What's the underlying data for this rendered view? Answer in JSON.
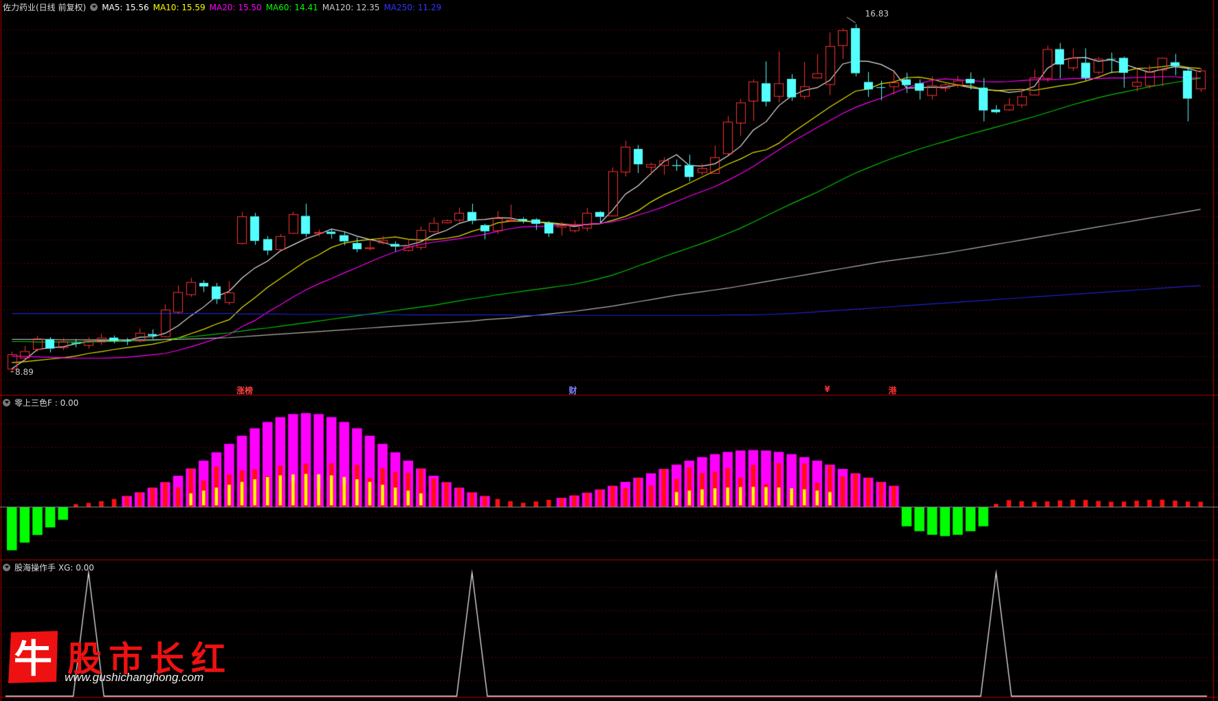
{
  "header": {
    "stock_title": "佐力药业(日线 前复权)",
    "ma_items": [
      {
        "label": "MA5: 15.56",
        "color": "#ffffff"
      },
      {
        "label": "MA10: 15.59",
        "color": "#ffff00"
      },
      {
        "label": "MA20: 15.50",
        "color": "#ff00ff"
      },
      {
        "label": "MA60: 14.41",
        "color": "#00ff00"
      },
      {
        "label": "MA120: 12.35",
        "color": "#cccccc"
      },
      {
        "label": "MA250: 11.29",
        "color": "#3030ff"
      }
    ]
  },
  "indicator1": {
    "title": "零上三色F : 0.00"
  },
  "indicator2": {
    "title": "股海操作手 XG: 0.00"
  },
  "annotations": {
    "high_label": "16.83",
    "low_label": "8.89",
    "event_markers": [
      {
        "text": "涨榜",
        "index": 18,
        "color": "#ff4040"
      },
      {
        "text": "财",
        "index": 44,
        "color": "#8080ff"
      },
      {
        "text": "¥",
        "index": 64,
        "color": "#ff3030"
      },
      {
        "text": "港",
        "index": 69,
        "color": "#ff3030"
      }
    ]
  },
  "watermark": {
    "brand_char": "牛",
    "text": "股市长红",
    "url": "www.gushichanghong.com"
  },
  "chart_data": {
    "type": "candlestick",
    "price_range": [
      8.6,
      17.1
    ],
    "candles": [
      [
        8.96,
        9.29,
        9.35,
        8.89
      ],
      [
        9.21,
        9.36,
        9.48,
        9.14
      ],
      [
        9.41,
        9.65,
        9.71,
        9.35
      ],
      [
        9.63,
        9.42,
        9.68,
        9.33
      ],
      [
        9.45,
        9.58,
        9.66,
        9.38
      ],
      [
        9.55,
        9.53,
        9.64,
        9.45
      ],
      [
        9.5,
        9.61,
        9.68,
        9.42
      ],
      [
        9.58,
        9.67,
        9.76,
        9.5
      ],
      [
        9.67,
        9.6,
        9.72,
        9.54
      ],
      [
        9.6,
        9.59,
        9.66,
        9.5
      ],
      [
        9.6,
        9.78,
        9.88,
        9.56
      ],
      [
        9.75,
        9.71,
        9.86,
        9.64
      ],
      [
        9.7,
        10.31,
        10.43,
        9.68
      ],
      [
        10.26,
        10.71,
        10.86,
        10.21
      ],
      [
        10.66,
        10.94,
        11.04,
        10.6
      ],
      [
        10.92,
        10.84,
        10.98,
        10.71
      ],
      [
        10.84,
        10.55,
        10.92,
        10.44
      ],
      [
        10.48,
        10.7,
        10.96,
        10.42
      ],
      [
        11.83,
        12.44,
        12.54,
        11.8
      ],
      [
        12.44,
        11.88,
        12.52,
        11.79
      ],
      [
        11.92,
        11.66,
        11.99,
        11.56
      ],
      [
        11.69,
        11.99,
        12.04,
        11.66
      ],
      [
        12.06,
        12.49,
        12.55,
        12.04
      ],
      [
        12.45,
        12.04,
        12.73,
        11.97
      ],
      [
        12.06,
        12.08,
        12.14,
        11.98
      ],
      [
        12.09,
        12.04,
        12.16,
        11.93
      ],
      [
        12.01,
        11.87,
        12.1,
        11.78
      ],
      [
        11.83,
        11.69,
        11.96,
        11.62
      ],
      [
        11.71,
        11.73,
        11.91,
        11.66
      ],
      [
        11.84,
        11.9,
        11.99,
        11.8
      ],
      [
        11.81,
        11.75,
        11.87,
        11.64
      ],
      [
        11.67,
        11.75,
        11.92,
        11.64
      ],
      [
        11.74,
        12.13,
        12.21,
        11.67
      ],
      [
        12.1,
        12.29,
        12.41,
        12.07
      ],
      [
        12.3,
        12.35,
        12.37,
        12.28
      ],
      [
        12.36,
        12.52,
        12.64,
        12.31
      ],
      [
        12.54,
        12.34,
        12.73,
        12.26
      ],
      [
        12.24,
        12.1,
        12.27,
        11.92
      ],
      [
        12.12,
        12.4,
        12.56,
        12.04
      ],
      [
        12.35,
        12.36,
        12.71,
        12.33
      ],
      [
        12.38,
        12.34,
        12.42,
        12.28
      ],
      [
        12.37,
        12.27,
        12.4,
        12.13
      ],
      [
        12.29,
        12.05,
        12.33,
        11.97
      ],
      [
        12.2,
        12.24,
        12.31,
        12.0
      ],
      [
        12.12,
        12.26,
        12.34,
        12.07
      ],
      [
        12.18,
        12.52,
        12.63,
        12.1
      ],
      [
        12.54,
        12.43,
        12.56,
        12.3
      ],
      [
        12.46,
        13.47,
        13.56,
        12.44
      ],
      [
        13.46,
        14.03,
        14.17,
        13.35
      ],
      [
        13.98,
        13.63,
        14.07,
        13.43
      ],
      [
        13.57,
        13.63,
        13.67,
        13.39
      ],
      [
        13.61,
        13.72,
        13.79,
        13.39
      ],
      [
        13.61,
        13.59,
        13.74,
        13.48
      ],
      [
        13.61,
        13.34,
        13.85,
        13.24
      ],
      [
        13.45,
        13.54,
        13.64,
        13.38
      ],
      [
        13.43,
        13.79,
        14.06,
        13.41
      ],
      [
        13.88,
        14.6,
        14.73,
        13.84
      ],
      [
        14.58,
        15.04,
        15.12,
        14.28
      ],
      [
        15.08,
        15.52,
        15.57,
        14.62
      ],
      [
        15.48,
        15.06,
        15.98,
        14.95
      ],
      [
        15.19,
        15.48,
        16.21,
        15.04
      ],
      [
        15.58,
        15.16,
        15.69,
        15.08
      ],
      [
        15.19,
        15.41,
        15.97,
        15.12
      ],
      [
        15.61,
        15.71,
        16.14,
        15.59
      ],
      [
        15.46,
        16.33,
        16.64,
        15.21
      ],
      [
        16.35,
        16.69,
        16.74,
        16.03
      ],
      [
        16.74,
        15.71,
        16.83,
        15.64
      ],
      [
        15.51,
        15.34,
        15.74,
        15.17
      ],
      [
        15.39,
        15.38,
        15.54,
        15.09
      ],
      [
        15.41,
        15.5,
        15.75,
        15.22
      ],
      [
        15.57,
        15.44,
        15.72,
        15.26
      ],
      [
        15.48,
        15.31,
        15.57,
        15.11
      ],
      [
        15.21,
        15.43,
        15.64,
        15.11
      ],
      [
        15.37,
        15.45,
        15.49,
        15.28
      ],
      [
        15.44,
        15.54,
        15.65,
        15.38
      ],
      [
        15.58,
        15.48,
        15.73,
        15.34
      ],
      [
        15.38,
        14.86,
        15.6,
        14.61
      ],
      [
        14.88,
        14.82,
        14.98,
        14.79
      ],
      [
        14.88,
        14.99,
        15.14,
        14.85
      ],
      [
        14.99,
        15.18,
        15.35,
        14.92
      ],
      [
        15.22,
        15.61,
        15.79,
        15.2
      ],
      [
        15.6,
        16.26,
        16.34,
        15.51
      ],
      [
        16.26,
        15.91,
        16.4,
        15.59
      ],
      [
        15.84,
        16.06,
        16.28,
        15.76
      ],
      [
        15.95,
        15.6,
        16.28,
        15.54
      ],
      [
        15.74,
        16.04,
        16.08,
        15.68
      ],
      [
        16.04,
        16.03,
        16.18,
        15.71
      ],
      [
        16.06,
        15.72,
        16.09,
        15.38
      ],
      [
        15.42,
        15.51,
        15.8,
        15.29
      ],
      [
        15.43,
        15.74,
        15.89,
        15.36
      ],
      [
        15.79,
        16.06,
        16.07,
        15.41
      ],
      [
        15.96,
        15.87,
        16.15,
        15.66
      ],
      [
        15.77,
        15.13,
        15.86,
        14.61
      ],
      [
        15.36,
        15.77,
        15.82,
        15.28
      ]
    ],
    "ma_lines": [
      {
        "name": "MA5",
        "color": "#e8e8e8",
        "values": [
          8.96,
          9.16,
          9.4,
          9.44,
          9.46,
          9.53,
          9.58,
          9.6,
          9.6,
          9.6,
          9.68,
          9.69,
          9.77,
          9.94,
          10.17,
          10.37,
          10.61,
          10.73,
          11.03,
          11.26,
          11.42,
          11.65,
          11.79,
          11.93,
          12.03,
          12.15,
          12.09,
          11.99,
          11.91,
          11.85,
          11.76,
          11.78,
          11.86,
          12.02,
          12.12,
          12.28,
          12.36,
          12.37,
          12.41,
          12.4,
          12.34,
          12.32,
          12.28,
          12.25,
          12.21,
          12.26,
          12.28,
          12.58,
          12.95,
          13.14,
          13.42,
          13.69,
          13.85,
          13.6,
          13.59,
          13.64,
          13.82,
          14.04,
          14.41,
          14.6,
          14.97,
          15.19,
          15.32,
          15.38,
          15.55,
          15.92,
          15.99,
          15.98,
          15.91,
          15.76,
          15.37,
          15.38,
          15.39,
          15.39,
          15.44,
          15.38,
          15.34,
          15.32,
          15.27,
          15.3,
          15.41,
          15.82,
          16.0,
          16.06,
          16.07,
          15.98,
          16.02,
          15.92,
          15.82,
          15.73,
          15.8,
          15.86,
          15.82,
          15.74
        ]
      },
      {
        "name": "MA10",
        "color": "#e8e800",
        "values": [
          9.1,
          9.12,
          9.15,
          9.18,
          9.21,
          9.25,
          9.31,
          9.35,
          9.4,
          9.44,
          9.48,
          9.52,
          9.58,
          9.66,
          9.76,
          9.86,
          9.98,
          10.08,
          10.36,
          10.58,
          10.82,
          11.02,
          11.22,
          11.42,
          11.56,
          11.73,
          11.83,
          11.88,
          11.91,
          11.94,
          11.97,
          11.92,
          11.9,
          11.91,
          11.94,
          11.99,
          12.1,
          12.18,
          12.29,
          12.33,
          12.33,
          12.31,
          12.3,
          12.27,
          12.24,
          12.25,
          12.27,
          12.35,
          12.44,
          12.57,
          12.77,
          12.93,
          13.06,
          13.2,
          13.34,
          13.48,
          13.63,
          13.75,
          13.9,
          13.96,
          14.11,
          14.34,
          14.54,
          14.74,
          14.94,
          15.12,
          15.3,
          15.35,
          15.47,
          15.51,
          15.61,
          15.62,
          15.57,
          15.5,
          15.44,
          15.42,
          15.34,
          15.31,
          15.33,
          15.34,
          15.32,
          15.37,
          15.42,
          15.46,
          15.53,
          15.62,
          15.73,
          15.75,
          15.82,
          15.83,
          15.86,
          15.9,
          15.84,
          15.82
        ]
      },
      {
        "name": "MA20",
        "color": "#ff00ff",
        "values": [
          9.25,
          9.24,
          9.23,
          9.22,
          9.21,
          9.2,
          9.2,
          9.2,
          9.21,
          9.22,
          9.25,
          9.28,
          9.31,
          9.38,
          9.46,
          9.55,
          9.65,
          9.74,
          9.92,
          10.06,
          10.25,
          10.42,
          10.6,
          10.76,
          10.9,
          11.02,
          11.15,
          11.27,
          11.4,
          11.52,
          11.63,
          11.73,
          11.8,
          11.85,
          11.89,
          11.93,
          11.98,
          12.03,
          12.1,
          12.16,
          12.2,
          12.21,
          12.22,
          12.23,
          12.24,
          12.26,
          12.28,
          12.32,
          12.38,
          12.47,
          12.56,
          12.66,
          12.78,
          12.9,
          13.01,
          13.12,
          13.26,
          13.41,
          13.58,
          13.77,
          13.96,
          14.14,
          14.3,
          14.47,
          14.63,
          14.79,
          14.93,
          15.04,
          15.14,
          15.26,
          15.37,
          15.47,
          15.55,
          15.58,
          15.56,
          15.54,
          15.52,
          15.51,
          15.52,
          15.54,
          15.56,
          15.56,
          15.57,
          15.59,
          15.59,
          15.59,
          15.6,
          15.6,
          15.61,
          15.62,
          15.63,
          15.63,
          15.6,
          15.6
        ]
      },
      {
        "name": "MA60",
        "color": "#00c800",
        "values": [
          9.58,
          9.58,
          9.57,
          9.57,
          9.57,
          9.57,
          9.57,
          9.58,
          9.58,
          9.59,
          9.6,
          9.61,
          9.63,
          9.66,
          9.69,
          9.72,
          9.75,
          9.78,
          9.82,
          9.86,
          9.89,
          9.93,
          9.97,
          10.01,
          10.05,
          10.09,
          10.13,
          10.17,
          10.21,
          10.25,
          10.29,
          10.33,
          10.37,
          10.41,
          10.46,
          10.51,
          10.56,
          10.6,
          10.65,
          10.69,
          10.73,
          10.77,
          10.81,
          10.85,
          10.89,
          10.95,
          11.02,
          11.1,
          11.2,
          11.31,
          11.41,
          11.52,
          11.62,
          11.72,
          11.82,
          11.93,
          12.05,
          12.17,
          12.31,
          12.45,
          12.59,
          12.73,
          12.86,
          12.99,
          13.14,
          13.29,
          13.43,
          13.55,
          13.67,
          13.78,
          13.88,
          13.98,
          14.07,
          14.15,
          14.24,
          14.32,
          14.4,
          14.48,
          14.56,
          14.64,
          14.72,
          14.81,
          14.9,
          14.99,
          15.07,
          15.15,
          15.22,
          15.28,
          15.34,
          15.4,
          15.45,
          15.5,
          15.55,
          15.6
        ]
      },
      {
        "name": "MA120",
        "color": "#b4b4b4",
        "values": [
          9.63,
          9.63,
          9.63,
          9.63,
          9.62,
          9.62,
          9.62,
          9.62,
          9.62,
          9.62,
          9.62,
          9.62,
          9.63,
          9.63,
          9.64,
          9.65,
          9.66,
          9.67,
          9.69,
          9.71,
          9.73,
          9.75,
          9.77,
          9.79,
          9.81,
          9.83,
          9.85,
          9.87,
          9.89,
          9.91,
          9.93,
          9.95,
          9.97,
          9.99,
          10.01,
          10.03,
          10.05,
          10.08,
          10.1,
          10.12,
          10.15,
          10.18,
          10.21,
          10.24,
          10.27,
          10.31,
          10.35,
          10.39,
          10.44,
          10.49,
          10.54,
          10.59,
          10.64,
          10.68,
          10.72,
          10.76,
          10.8,
          10.85,
          10.9,
          10.95,
          11.0,
          11.05,
          11.1,
          11.15,
          11.2,
          11.25,
          11.3,
          11.35,
          11.4,
          11.44,
          11.48,
          11.52,
          11.56,
          11.6,
          11.65,
          11.7,
          11.75,
          11.8,
          11.85,
          11.9,
          11.95,
          12.0,
          12.05,
          12.1,
          12.15,
          12.2,
          12.25,
          12.3,
          12.35,
          12.4,
          12.45,
          12.5,
          12.55,
          12.6
        ]
      },
      {
        "name": "MA250",
        "color": "#2020d0",
        "values": [
          10.22,
          10.22,
          10.22,
          10.22,
          10.22,
          10.22,
          10.22,
          10.22,
          10.22,
          10.22,
          10.22,
          10.22,
          10.22,
          10.22,
          10.22,
          10.22,
          10.22,
          10.22,
          10.21,
          10.21,
          10.21,
          10.21,
          10.2,
          10.2,
          10.2,
          10.2,
          10.2,
          10.2,
          10.2,
          10.2,
          10.2,
          10.19,
          10.19,
          10.19,
          10.19,
          10.19,
          10.19,
          10.19,
          10.19,
          10.19,
          10.18,
          10.18,
          10.18,
          10.18,
          10.18,
          10.18,
          10.18,
          10.18,
          10.18,
          10.18,
          10.18,
          10.18,
          10.18,
          10.18,
          10.18,
          10.18,
          10.19,
          10.19,
          10.19,
          10.2,
          10.21,
          10.22,
          10.24,
          10.26,
          10.28,
          10.3,
          10.32,
          10.34,
          10.36,
          10.38,
          10.4,
          10.42,
          10.44,
          10.46,
          10.48,
          10.5,
          10.52,
          10.54,
          10.56,
          10.58,
          10.6,
          10.62,
          10.64,
          10.66,
          10.68,
          10.7,
          10.72,
          10.74,
          10.76,
          10.78,
          10.8,
          10.82,
          10.84,
          10.86
        ]
      }
    ],
    "indicator1": {
      "magenta": [
        0,
        0,
        0,
        0,
        0,
        0,
        0,
        0,
        0,
        0,
        0,
        0,
        0,
        0,
        0,
        0,
        0,
        0,
        0,
        0,
        0,
        0,
        0,
        0,
        0,
        0,
        0,
        0,
        0,
        0,
        0,
        0,
        0,
        0,
        0,
        0,
        0,
        0,
        0,
        0,
        0,
        0,
        0,
        0,
        0,
        0,
        0,
        0,
        0,
        0,
        0,
        0,
        0,
        0,
        0,
        0,
        0,
        0,
        0,
        0,
        0,
        0,
        0,
        0,
        0,
        0,
        0,
        0,
        0,
        0,
        0,
        0,
        0,
        0,
        0,
        0,
        0,
        0,
        0,
        0,
        0,
        0,
        0,
        0,
        0,
        0,
        0,
        0,
        0,
        0,
        0,
        0,
        0,
        0
      ],
      "red": [],
      "yellow": []
    },
    "xg_peaks": [
      6,
      36,
      77
    ]
  }
}
